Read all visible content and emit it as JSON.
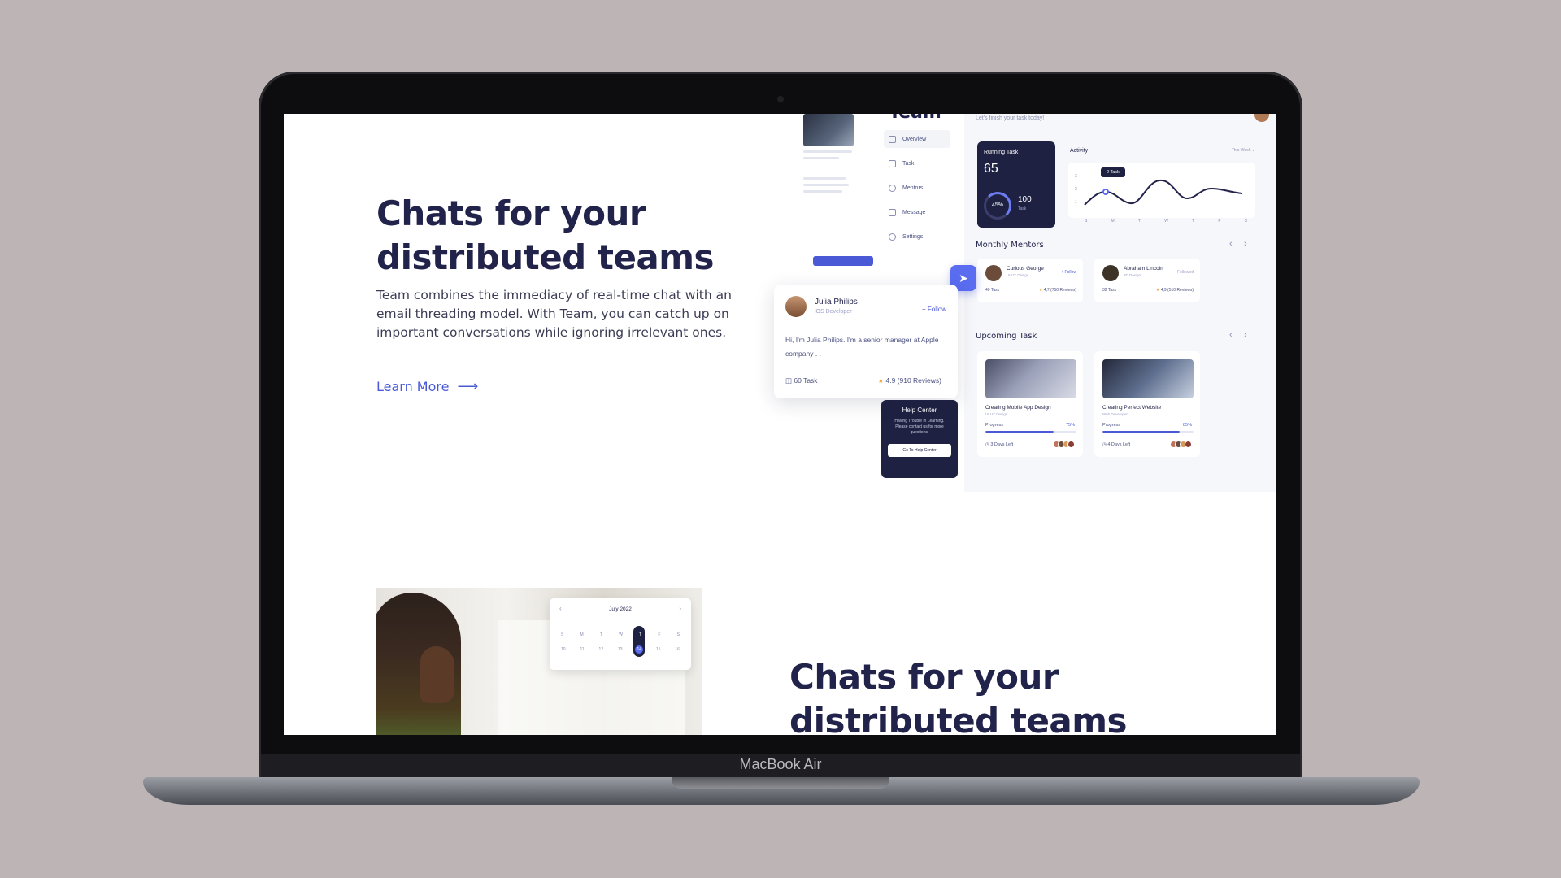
{
  "hero": {
    "title": "Chats for your distributed teams",
    "description": "Team combines the immediacy of real-time chat with an email threading model. With Team, you can catch up on important conversations while ignoring irrelevant ones.",
    "learn_more": "Learn More",
    "learn_more_icon": "arrow-right-icon"
  },
  "dashboard": {
    "brand": "Team",
    "greeting": "Let's finish your task today!",
    "sidebar": [
      {
        "label": "Overview",
        "icon": "grid-icon"
      },
      {
        "label": "Task",
        "icon": "book-icon"
      },
      {
        "label": "Mentors",
        "icon": "user-icon"
      },
      {
        "label": "Message",
        "icon": "message-icon"
      },
      {
        "label": "Settings",
        "icon": "gear-icon"
      }
    ],
    "help": {
      "title": "Help Center",
      "text": "Having Trouble in Learning. Please contact us for more questions.",
      "button": "Go To Help Center"
    },
    "running_task": {
      "label": "Running Task",
      "value": "65",
      "percent": "45%",
      "total": "100",
      "total_label": "Task"
    },
    "activity": {
      "title": "Activity",
      "range": "This Week",
      "tooltip": "2 Task",
      "y_ticks": [
        "3",
        "2",
        "1"
      ],
      "days": [
        "S",
        "M",
        "T",
        "W",
        "T",
        "F",
        "S"
      ]
    },
    "mentors": {
      "title": "Monthly Mentors",
      "items": [
        {
          "name": "Curious George",
          "role": "UI UX Design",
          "action": "+ Follow",
          "tasks": "40 Task",
          "rating": "4,7 (750 Reviews)"
        },
        {
          "name": "Abraham Lincoln",
          "role": "3D Design",
          "action": "Followed",
          "tasks": "32 Task",
          "rating": "4,9 (510 Reviews)"
        }
      ]
    },
    "upcoming": {
      "title": "Upcoming Task",
      "items": [
        {
          "name": "Creating Mobile App Design",
          "role": "UI UX Design",
          "progress_label": "Progress",
          "progress": "75%",
          "progress_value": 0.75,
          "left": "3 Days Left"
        },
        {
          "name": "Creating Perfect Website",
          "role": "Web Developer",
          "progress_label": "Progress",
          "progress": "85%",
          "progress_value": 0.85,
          "left": "4 Days Left"
        }
      ]
    },
    "profile": {
      "name": "Julia Philips",
      "role": "iOS Developer",
      "follow": "+ Follow",
      "bio": "Hi, I'm Julia Philips. I'm a senior manager at Apple company . . .",
      "tasks": "60 Task",
      "rating": "4.9 (910 Reviews)"
    }
  },
  "calendar": {
    "month": "July 2022",
    "weekdays": [
      "S",
      "M",
      "T",
      "W",
      "T",
      "F",
      "S"
    ],
    "dates": [
      "10",
      "11",
      "12",
      "13",
      "14",
      "15",
      "16"
    ]
  },
  "section2": {
    "title": "Chats for your distributed teams"
  },
  "device": {
    "label": "MacBook Air"
  },
  "colors": {
    "accent": "#4a5ad6",
    "navy": "#22234a",
    "background": "#bdb4b5"
  }
}
